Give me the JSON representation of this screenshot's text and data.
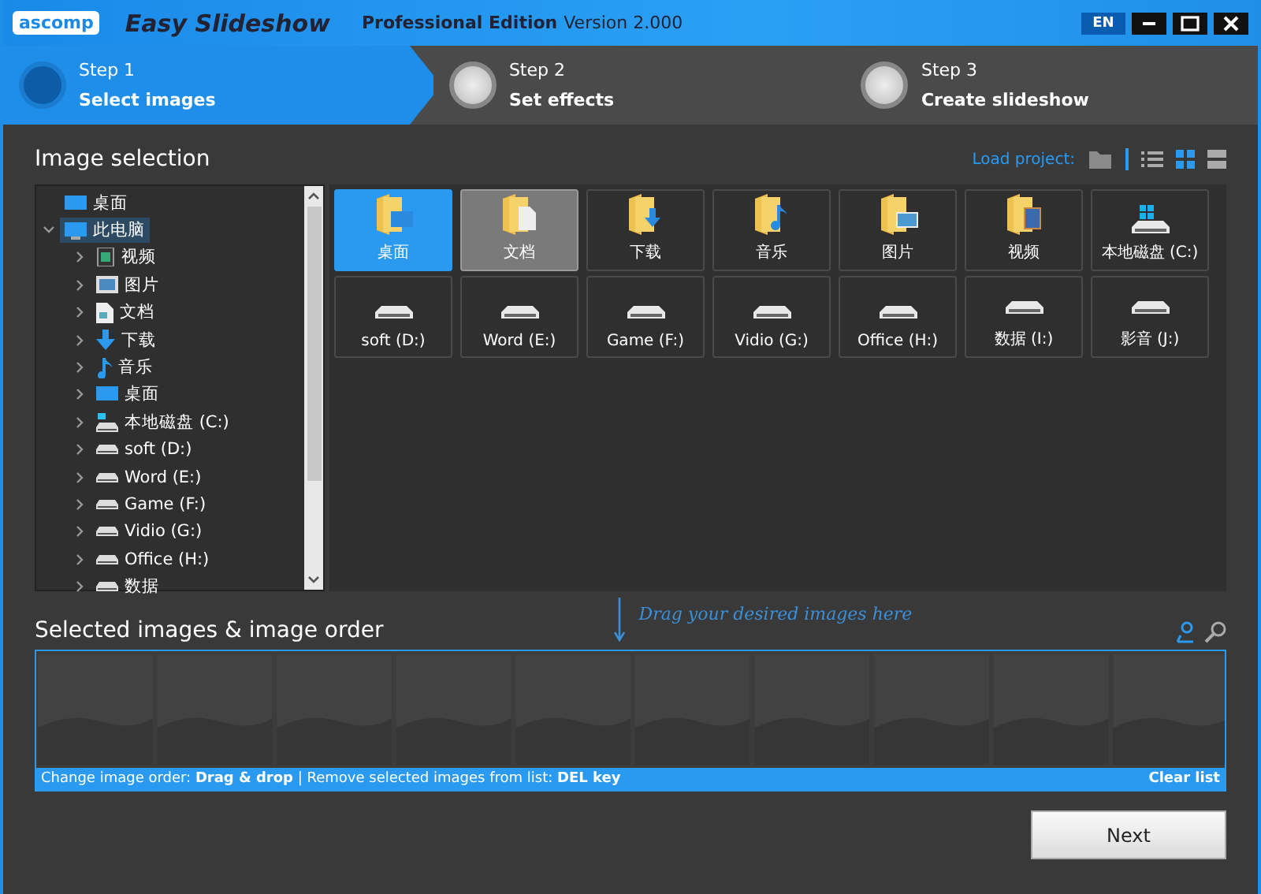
{
  "app": {
    "logo": "ascomp",
    "title": "Easy Slideshow",
    "edition": "Professional Edition",
    "version": "Version 2.000",
    "language": "EN"
  },
  "steps": [
    {
      "step": "Step 1",
      "label": "Select images",
      "selected": true
    },
    {
      "step": "Step 2",
      "label": "Set effects",
      "selected": false
    },
    {
      "step": "Step 3",
      "label": "Create slideshow",
      "selected": false
    }
  ],
  "image_selection": {
    "title": "Image selection",
    "load_project": "Load project:",
    "views": [
      {
        "kind": "list",
        "selected": false
      },
      {
        "kind": "tiles",
        "selected": true
      },
      {
        "kind": "large",
        "selected": false
      }
    ]
  },
  "tree": [
    {
      "label": "桌面",
      "kind": "desktop",
      "selected": false
    },
    {
      "label": "此电脑",
      "kind": "pc",
      "selected": true,
      "expanded": true,
      "children": [
        {
          "label": "视频",
          "kind": "video",
          "selected": false,
          "expanded": false
        },
        {
          "label": "图片",
          "kind": "pictures",
          "selected": false,
          "expanded": false
        },
        {
          "label": "文档",
          "kind": "docs",
          "selected": false,
          "expanded": false
        },
        {
          "label": "下载",
          "kind": "download",
          "selected": false,
          "expanded": false
        },
        {
          "label": "音乐",
          "kind": "music",
          "selected": false,
          "expanded": false
        },
        {
          "label": "桌面",
          "kind": "desktop",
          "selected": false,
          "expanded": false
        },
        {
          "label": "本地磁盘 (C:)",
          "kind": "system-drive",
          "selected": false,
          "expanded": false
        },
        {
          "label": "soft (D:)",
          "kind": "drive",
          "selected": false,
          "expanded": false
        },
        {
          "label": "Word (E:)",
          "kind": "drive",
          "selected": false,
          "expanded": false
        },
        {
          "label": "Game (F:)",
          "kind": "drive",
          "selected": false,
          "expanded": false
        },
        {
          "label": "Vidio (G:)",
          "kind": "drive",
          "selected": false,
          "expanded": false
        },
        {
          "label": "Office (H:)",
          "kind": "drive",
          "selected": false,
          "expanded": false
        },
        {
          "label": "数据",
          "kind": "drive",
          "selected": false,
          "expanded": false
        }
      ]
    }
  ],
  "tiles": [
    {
      "label": "桌面",
      "kind": "desktop",
      "selected": true,
      "hovered": false
    },
    {
      "label": "文档",
      "kind": "docs",
      "selected": false,
      "hovered": true
    },
    {
      "label": "下载",
      "kind": "download",
      "selected": false,
      "hovered": false
    },
    {
      "label": "音乐",
      "kind": "music",
      "selected": false,
      "hovered": false
    },
    {
      "label": "图片",
      "kind": "pictures",
      "selected": false,
      "hovered": false
    },
    {
      "label": "视频",
      "kind": "video",
      "selected": false,
      "hovered": false
    },
    {
      "label": "本地磁盘 (C:)",
      "kind": "system-drive",
      "selected": false,
      "hovered": false
    },
    {
      "label": "soft (D:)",
      "kind": "drive",
      "selected": false,
      "hovered": false
    },
    {
      "label": "Word (E:)",
      "kind": "drive",
      "selected": false,
      "hovered": false
    },
    {
      "label": "Game (F:)",
      "kind": "drive",
      "selected": false,
      "hovered": false
    },
    {
      "label": "Vidio (G:)",
      "kind": "drive",
      "selected": false,
      "hovered": false
    },
    {
      "label": "Office (H:)",
      "kind": "drive",
      "selected": false,
      "hovered": false
    },
    {
      "label": "数据 (I:)",
      "kind": "drive",
      "selected": false,
      "hovered": false
    },
    {
      "label": "影音 (J:)",
      "kind": "drive",
      "selected": false,
      "hovered": false
    }
  ],
  "selected_images": {
    "title": "Selected images & image order",
    "drag_hint": "Drag your desired images here",
    "footer": "Change image order: **Drag & drop** | Remove selected images from list: **DEL key**",
    "clear": "Clear list"
  },
  "next": "Next"
}
